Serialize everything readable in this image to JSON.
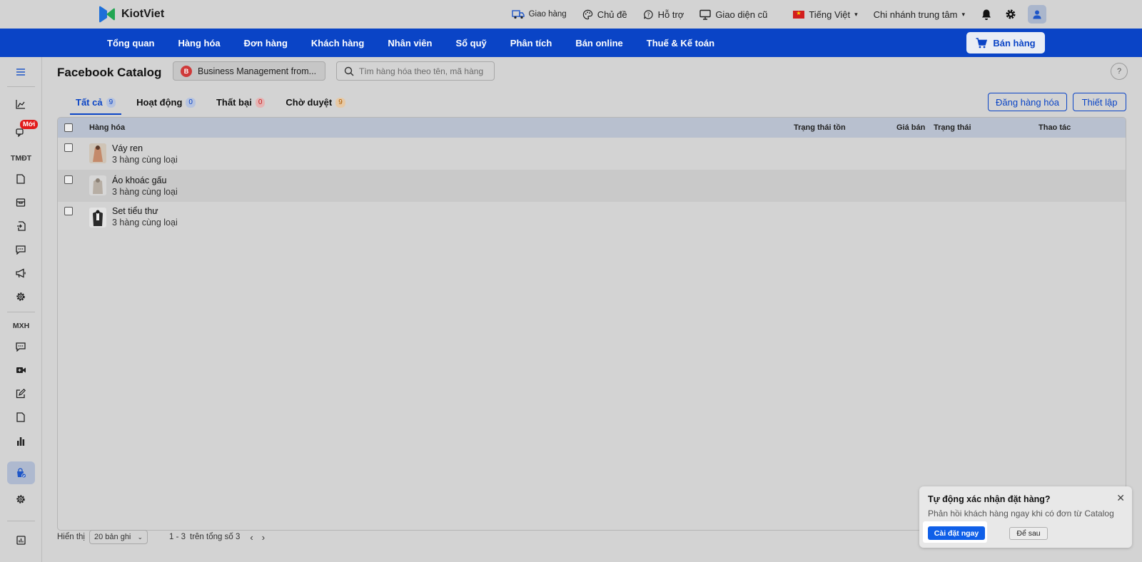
{
  "app": {
    "logo_text": "KiotViet",
    "brand_colors": {
      "blue": "#0a44c6",
      "green": "#1aa14a"
    }
  },
  "topbar": {
    "delivery": "Giao hàng",
    "theme": "Chủ đề",
    "support": "Hỗ trợ",
    "old_ui": "Giao diện cũ",
    "language": "Tiếng Việt",
    "branch": "Chi nhánh trung tâm",
    "icons": [
      "truck-icon",
      "palette-icon",
      "chat-support-icon",
      "monitor-icon",
      "vn-flag-icon",
      "bell-icon",
      "gear-icon",
      "user-icon"
    ]
  },
  "nav": {
    "items": [
      "Tổng quan",
      "Hàng hóa",
      "Đơn hàng",
      "Khách hàng",
      "Nhân viên",
      "Sổ quỹ",
      "Phân tích",
      "Bán online",
      "Thuế & Kế toán"
    ],
    "sell_button": "Bán hàng"
  },
  "sidebar": {
    "new_badge": "Mới",
    "section_ecommerce": "TMĐT",
    "section_social": "MXH",
    "active_item": "facebook-catalog"
  },
  "page": {
    "title": "Facebook Catalog",
    "business_select": "Business Management from...",
    "business_initial": "B",
    "search_placeholder": "Tìm hàng hóa theo tên, mã hàng",
    "help": "?"
  },
  "tabs": [
    {
      "label": "Tất cả",
      "count": "9",
      "active": true
    },
    {
      "label": "Hoạt động",
      "count": "0"
    },
    {
      "label": "Thất bại",
      "count": "0"
    },
    {
      "label": "Chờ duyệt",
      "count": "9"
    }
  ],
  "actions": {
    "post_products": "Đăng hàng hóa",
    "settings": "Thiết lập"
  },
  "table": {
    "columns": [
      "Hàng hóa",
      "Trạng thái tồn",
      "Giá bán",
      "Trạng thái",
      "Thao tác"
    ],
    "rows": [
      {
        "name": "Váy ren",
        "variants": "3 hàng cùng loại"
      },
      {
        "name": "Áo khoác gấu",
        "variants": "3 hàng cùng loại"
      },
      {
        "name": "Set tiểu thư",
        "variants": "3 hàng cùng loại"
      }
    ]
  },
  "footer": {
    "show_label": "Hiển thị",
    "page_size": "20 bản ghi",
    "range": "1 - 3",
    "range_of": "trên tổng số 3"
  },
  "toast": {
    "title": "Tự động xác nhận đặt hàng?",
    "message": "Phản hồi khách hàng ngay khi có đơn từ Catalog",
    "primary": "Cài đặt ngay",
    "secondary": "Để sau"
  }
}
